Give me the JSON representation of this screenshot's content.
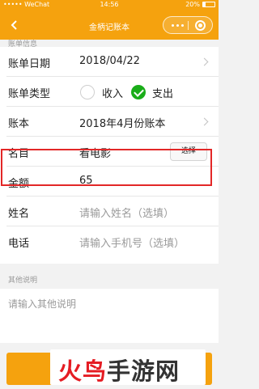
{
  "status_bar": {
    "carrier": "••••• WeChat",
    "time": "14:56",
    "battery": "20%",
    "battery_level": 0.2
  },
  "nav": {
    "title": "金柄记账本"
  },
  "bill_info": {
    "section_label": "账单信息",
    "date": {
      "label": "账单日期",
      "value": "2018/04/22"
    },
    "type": {
      "label": "账单类型",
      "options": [
        "收入",
        "支出"
      ],
      "selected": "支出"
    },
    "book": {
      "label": "账本",
      "value": "2018年4月份账本"
    },
    "item": {
      "label": "名目",
      "value": "看电影",
      "select_button": "选择"
    },
    "amount": {
      "label": "金额",
      "value": "65"
    },
    "name": {
      "label": "姓名",
      "placeholder": "请输入姓名（选填）"
    },
    "phone": {
      "label": "电话",
      "placeholder": "请输入手机号（选填）"
    }
  },
  "other": {
    "section_label": "其他说明",
    "placeholder": "请输入其他说明"
  },
  "watermark": {
    "part1": "火鸟",
    "part2": "手游网"
  },
  "colors": {
    "accent": "#f5a20e",
    "checked": "#1aad19",
    "highlight": "#e32727",
    "watermark_red": "#e51c23"
  }
}
